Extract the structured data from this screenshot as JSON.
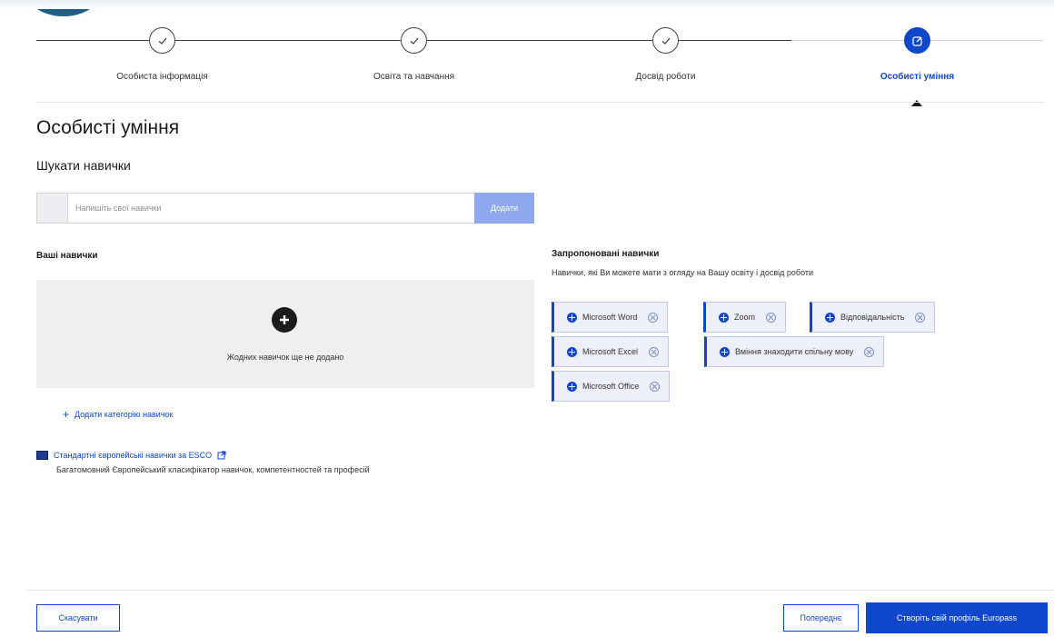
{
  "stepper": {
    "steps": [
      {
        "label": "Особиста інформація",
        "state": "completed",
        "icon": "check-icon"
      },
      {
        "label": "Освіта та навчання",
        "state": "completed",
        "icon": "check-icon"
      },
      {
        "label": "Досвід роботи",
        "state": "completed",
        "icon": "check-icon"
      },
      {
        "label": "Особисті уміння",
        "state": "active",
        "icon": "edit-icon"
      }
    ]
  },
  "page": {
    "title": "Особисті уміння",
    "search_title": "Шукати навички"
  },
  "search": {
    "placeholder": "Напишіть свої навички",
    "add_label": "Додати"
  },
  "your_skills": {
    "title": "Ваші навички",
    "empty_text": "Жодних навичок ще не додано",
    "add_category": "Додати категорію навичок"
  },
  "esco": {
    "link": "Стандартні європейські навички за ESCO",
    "description": "Багатомовний Європейський класифікатор навичок, компетентностей та професій"
  },
  "suggested": {
    "title": "Запропоновані навички",
    "subtitle": "Навички, які Ви можете мати з огляду на Вашу освіту і досвід роботи",
    "chips": [
      "Microsoft Word",
      "Zoom",
      "Відповідальність",
      "Microsoft Excel",
      "Вміння знаходити спільну мову",
      "Microsoft Office"
    ]
  },
  "footer": {
    "cancel": "Скасувати",
    "previous": "Попереднє",
    "create": "Створіть свій профіль Europass"
  },
  "colors": {
    "primary": "#0e47cb",
    "add_button_disabled": "#8ea9ee",
    "empty_box": "#efefef"
  }
}
